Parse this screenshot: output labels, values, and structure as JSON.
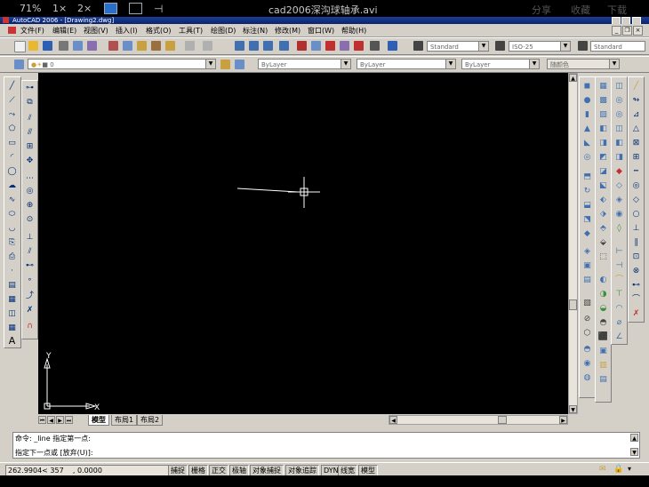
{
  "player": {
    "zoom": "71%",
    "speed1": "1×",
    "speed2": "2×",
    "filename": "cad2006深沟球轴承.avi",
    "share": "分享",
    "favorite": "收藏",
    "download": "下载"
  },
  "window": {
    "title": "AutoCAD 2006 - [Drawing2.dwg]"
  },
  "menu": {
    "items": [
      "文件(F)",
      "编辑(E)",
      "视图(V)",
      "插入(I)",
      "格式(O)",
      "工具(T)",
      "绘图(D)",
      "标注(N)",
      "修改(M)",
      "窗口(W)",
      "帮助(H)"
    ]
  },
  "styles": {
    "text_style": "Standard",
    "dim_style": "ISO-25",
    "table_style": "Standard"
  },
  "layers": {
    "current_layer": "0",
    "color": "ByLayer",
    "linetype": "ByLayer",
    "lineweight": "ByLayer",
    "plot_style": "随颜色"
  },
  "ucs": {
    "x_label": "X",
    "y_label": "Y"
  },
  "tabs": {
    "model": "模型",
    "layout1": "布局1",
    "layout2": "布局2"
  },
  "command": {
    "line1": "命令: _line 指定第一点:",
    "line2": "指定下一点或 [放弃(U)]:"
  },
  "status": {
    "coords": "262.9904< 357    , 0.0000",
    "buttons": [
      "捕捉",
      "栅格",
      "正交",
      "极轴",
      "对象捕捉",
      "对象追踪",
      "DYN",
      "线宽",
      "模型"
    ]
  },
  "colors": {
    "canvas": "#000000",
    "titlebar": "#0a246a",
    "ui_face": "#d4d0c8"
  }
}
